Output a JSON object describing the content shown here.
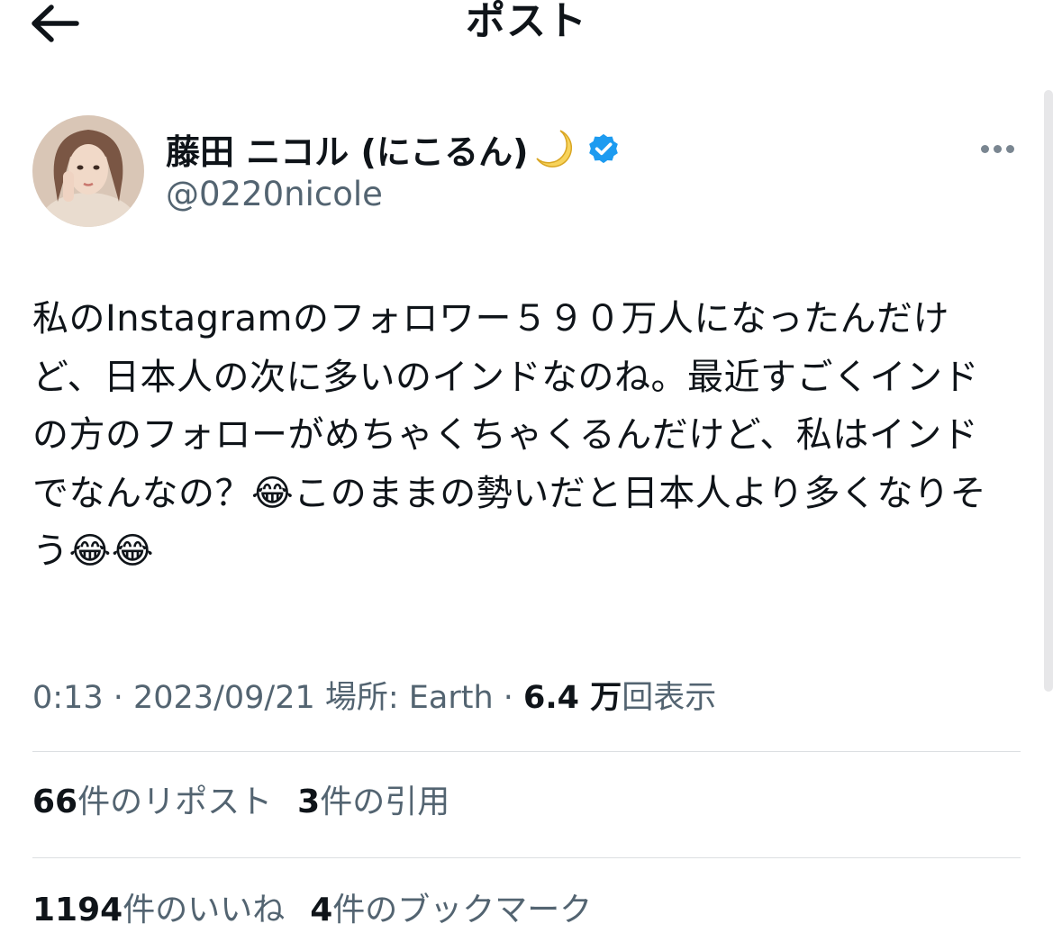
{
  "header": {
    "title": "ポスト",
    "back_icon": "arrow-left-icon"
  },
  "author": {
    "display_name": "藤田 ニコル (にこるん)",
    "name_emoji": "crescent-moon-emoji",
    "verified_icon": "verified-badge-icon",
    "verified_color": "#1d9bf0",
    "handle": "@0220nicole",
    "more_icon": "more-horizontal-icon"
  },
  "tweet": {
    "text": "私のInstagramのフォロワー５９０万人になったんだけど、日本人の次に多いのインドなのね。最近すごくインドの方のフォローがめちゃくちゃくるんだけど、私はインドでなんなの？😂このままの勢いだと日本人より多くなりそう😂😂"
  },
  "meta": {
    "time": "0:13",
    "sep1": " · ",
    "date": "2023/09/21",
    "location": " 場所: Earth",
    "sep2": " · ",
    "views_count": "6.4 万",
    "views_label": "回表示"
  },
  "stats": {
    "reposts_count": "66",
    "reposts_label": "件のリポスト",
    "quotes_count": "3",
    "quotes_label": "件の引用",
    "likes_count": "1194",
    "likes_label": "件のいいね",
    "bookmarks_count": "4",
    "bookmarks_label": "件のブックマーク"
  },
  "colors": {
    "text_primary": "#0f1419",
    "text_secondary": "#536471",
    "divider": "#dcdfe2"
  }
}
